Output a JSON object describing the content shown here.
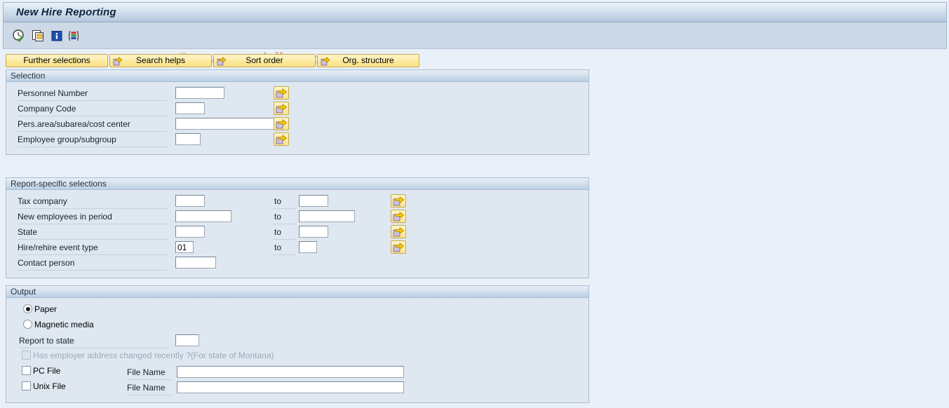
{
  "window": {
    "title": "New Hire Reporting"
  },
  "watermark": "© www.tutorialkart.com",
  "toolbar": {
    "icons": [
      {
        "name": "execute-icon",
        "title": "Execute (F8)"
      },
      {
        "name": "multiple-selection-icon",
        "title": "Multiple selection"
      },
      {
        "name": "info-icon",
        "title": "Information"
      },
      {
        "name": "variant-icon",
        "title": "Get variant"
      }
    ]
  },
  "action_buttons": [
    {
      "label": "Further selections",
      "has_arrow": false
    },
    {
      "label": "Search helps",
      "has_arrow": true
    },
    {
      "label": "Sort order",
      "has_arrow": true
    },
    {
      "label": "Org. structure",
      "has_arrow": true
    }
  ],
  "selection": {
    "title": "Selection",
    "rows": [
      {
        "label": "Personnel Number",
        "value": "",
        "select_button": "multiple-selection-arrow"
      },
      {
        "label": "Company Code",
        "value": "",
        "select_button": "multiple-selection-arrow"
      },
      {
        "label": "Pers.area/subarea/cost center",
        "value": "",
        "select_button": "multiple-selection-arrow"
      },
      {
        "label": "Employee group/subgroup",
        "value": "",
        "select_button": "multiple-selection-arrow"
      }
    ]
  },
  "report_specific": {
    "title": "Report-specific selections",
    "to_label": "to",
    "rows": [
      {
        "label": "Tax company",
        "value": "",
        "to_value": "",
        "has_to": true,
        "select_button": "multiple-selection-arrow"
      },
      {
        "label": "New employees in period",
        "value": "",
        "to_value": "",
        "has_to": true,
        "select_button": "multiple-selection-arrow"
      },
      {
        "label": "State",
        "value": "",
        "to_value": "",
        "has_to": true,
        "select_button": "multiple-selection-arrow"
      },
      {
        "label": "Hire/rehire event type",
        "value": "01",
        "to_value": "",
        "has_to": true,
        "select_button": "multiple-selection-arrow"
      },
      {
        "label": "Contact person",
        "value": "",
        "to_value": "",
        "has_to": false,
        "select_button": null
      }
    ]
  },
  "output": {
    "title": "Output",
    "radio_paper": {
      "label": "Paper",
      "selected": true
    },
    "radio_magnetic": {
      "label": "Magnetic media",
      "selected": false
    },
    "report_to_state": {
      "label": "Report to state",
      "value": ""
    },
    "montana_check": {
      "label": "Has employer address changed recently ?(For state of Montana)",
      "checked": false,
      "disabled": true
    },
    "pc_file": {
      "label": "PC File",
      "checked": false,
      "file_name_label": "File Name",
      "file_name_value": ""
    },
    "unix_file": {
      "label": "Unix File",
      "checked": false,
      "file_name_label": "File Name",
      "file_name_value": ""
    }
  },
  "colors": {
    "page_background": "#eaf0f8",
    "titlebar_top": "#eaf1f9",
    "titlebar_bottom": "#aec3da",
    "toolbar_background": "#cdd9e6",
    "group_background": "#dfe8f1",
    "group_border": "#a9bdd2",
    "button_yellow": "#fce89a",
    "button_border": "#c8a94e",
    "watermark": "#e2a87c",
    "arrow_yellow": "#ffcc00"
  }
}
